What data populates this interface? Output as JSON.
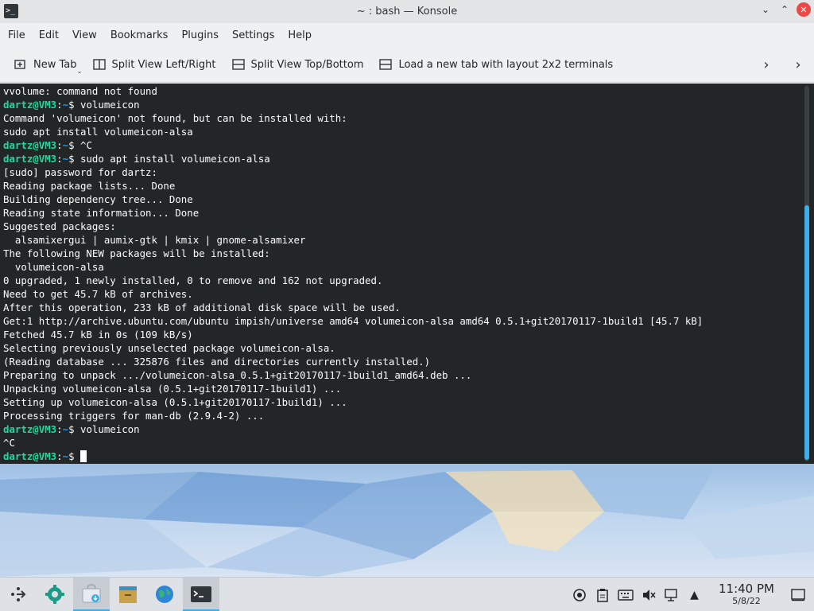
{
  "window": {
    "title": "~ : bash — Konsole",
    "controls": {
      "minimize": "⌄",
      "maximize": "⌃",
      "close": "✕"
    }
  },
  "menu": [
    "File",
    "Edit",
    "View",
    "Bookmarks",
    "Plugins",
    "Settings",
    "Help"
  ],
  "toolbar": {
    "new_tab": "New Tab",
    "split_lr": "Split View Left/Right",
    "split_tb": "Split View Top/Bottom",
    "layout_2x2": "Load a new tab with layout 2x2 terminals"
  },
  "terminal": {
    "prompt_user": "dartz@VM3",
    "prompt_path": "~",
    "lines": [
      {
        "text": "vvolume: command not found"
      },
      {
        "prompt": true,
        "cmd": " volumeicon"
      },
      {
        "text": "Command 'volumeicon' not found, but can be installed with:"
      },
      {
        "text": "sudo apt install volumeicon-alsa"
      },
      {
        "prompt": true,
        "cmd": " ^C"
      },
      {
        "prompt": true,
        "cmd": " sudo apt install volumeicon-alsa"
      },
      {
        "text": "[sudo] password for dartz:"
      },
      {
        "text": "Reading package lists... Done"
      },
      {
        "text": "Building dependency tree... Done"
      },
      {
        "text": "Reading state information... Done"
      },
      {
        "text": "Suggested packages:"
      },
      {
        "text": "  alsamixergui | aumix-gtk | kmix | gnome-alsamixer"
      },
      {
        "text": "The following NEW packages will be installed:"
      },
      {
        "text": "  volumeicon-alsa"
      },
      {
        "text": "0 upgraded, 1 newly installed, 0 to remove and 162 not upgraded."
      },
      {
        "text": "Need to get 45.7 kB of archives."
      },
      {
        "text": "After this operation, 233 kB of additional disk space will be used."
      },
      {
        "text": "Get:1 http://archive.ubuntu.com/ubuntu impish/universe amd64 volumeicon-alsa amd64 0.5.1+git20170117-1build1 [45.7 kB]"
      },
      {
        "text": "Fetched 45.7 kB in 0s (109 kB/s)"
      },
      {
        "text": "Selecting previously unselected package volumeicon-alsa."
      },
      {
        "text": "(Reading database ... 325876 files and directories currently installed.)"
      },
      {
        "text": "Preparing to unpack .../volumeicon-alsa_0.5.1+git20170117-1build1_amd64.deb ..."
      },
      {
        "text": "Unpacking volumeicon-alsa (0.5.1+git20170117-1build1) ..."
      },
      {
        "text": "Setting up volumeicon-alsa (0.5.1+git20170117-1build1) ..."
      },
      {
        "text": "Processing triggers for man-db (2.9.4-2) ..."
      },
      {
        "prompt": true,
        "cmd": " volumeicon"
      },
      {
        "text": "^C"
      },
      {
        "prompt": true,
        "cmd": " ",
        "cursor": true
      }
    ]
  },
  "taskbar": {
    "apps": [
      {
        "name": "application-launcher-icon",
        "active": false
      },
      {
        "name": "settings-gear-icon",
        "active": false
      },
      {
        "name": "discover-store-icon",
        "active": true
      },
      {
        "name": "file-manager-icon",
        "active": false
      },
      {
        "name": "web-browser-icon",
        "active": false
      },
      {
        "name": "konsole-terminal-icon",
        "active": true
      }
    ],
    "clock_time": "11:40 PM",
    "clock_date": "5/8/22"
  },
  "colors": {
    "accent": "#3daee9",
    "terminal_bg": "#232627",
    "prompt_user": "#1cdc9a",
    "prompt_path": "#1d99f3",
    "close_button": "#ed4747"
  }
}
